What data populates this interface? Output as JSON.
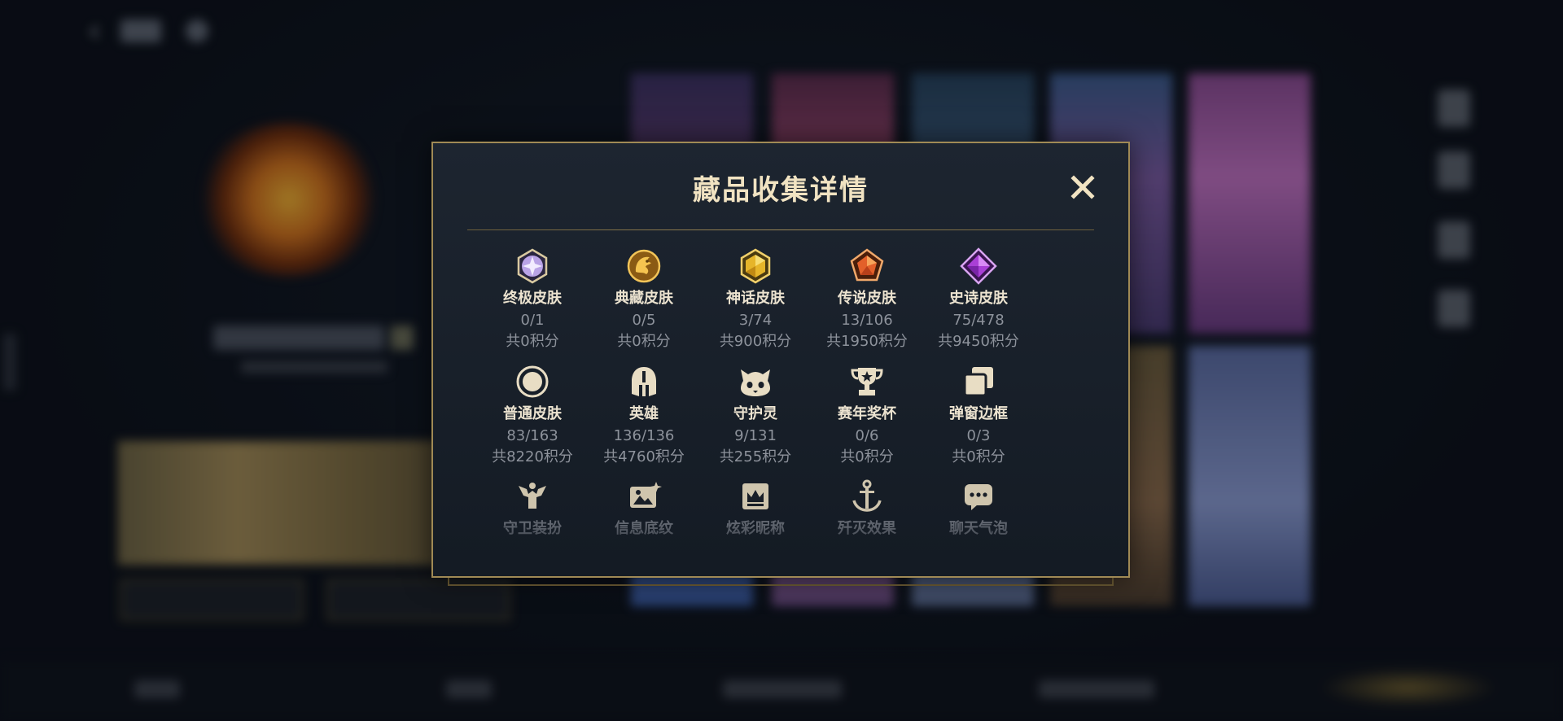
{
  "modal": {
    "title": "藏品收集详情",
    "row1": [
      {
        "name": "终极皮肤",
        "count": "0/1",
        "points": "共0积分",
        "icon": "ultimate-skin-gem-icon",
        "color": "#b9a3e6"
      },
      {
        "name": "典藏皮肤",
        "count": "0/5",
        "points": "共0积分",
        "icon": "collector-skin-dragon-icon",
        "color": "#e1a22f"
      },
      {
        "name": "神话皮肤",
        "count": "3/74",
        "points": "共900积分",
        "icon": "mythic-skin-gem-icon",
        "color": "#e6b52a"
      },
      {
        "name": "传说皮肤",
        "count": "13/106",
        "points": "共1950积分",
        "icon": "legendary-skin-gem-icon",
        "color": "#e3602a"
      },
      {
        "name": "史诗皮肤",
        "count": "75/478",
        "points": "共9450积分",
        "icon": "epic-skin-gem-icon",
        "color": "#a93fd6"
      }
    ],
    "row2": [
      {
        "name": "普通皮肤",
        "count": "83/163",
        "points": "共8220积分",
        "icon": "normal-skin-circle-icon"
      },
      {
        "name": "英雄",
        "count": "136/136",
        "points": "共4760积分",
        "icon": "hero-helmet-icon"
      },
      {
        "name": "守护灵",
        "count": "9/131",
        "points": "共255积分",
        "icon": "guardian-spirit-icon"
      },
      {
        "name": "赛年奖杯",
        "count": "0/6",
        "points": "共0积分",
        "icon": "season-trophy-icon"
      },
      {
        "name": "弹窗边框",
        "count": "0/3",
        "points": "共0积分",
        "icon": "popup-frame-icon"
      }
    ],
    "row3": [
      {
        "name": "守卫装扮",
        "icon": "guard-outfit-icon"
      },
      {
        "name": "信息底纹",
        "icon": "info-background-icon"
      },
      {
        "name": "炫彩昵称",
        "icon": "colorful-nickname-icon"
      },
      {
        "name": "歼灭效果",
        "icon": "kill-effect-icon"
      },
      {
        "name": "聊天气泡",
        "icon": "chat-bubble-icon"
      }
    ]
  },
  "colors": {
    "accent_gold": "#a08a55",
    "title_text": "#f1e3c2",
    "secondary_text": "#8d929b"
  }
}
